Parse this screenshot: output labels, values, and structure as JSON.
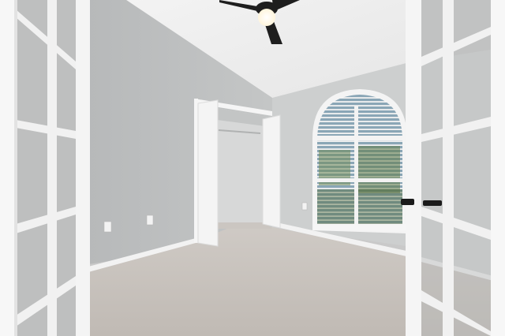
{
  "scene": {
    "description_kind": "real-estate-photo",
    "palette": {
      "ceiling": "#efefef",
      "left_wall": "#c1c3c3",
      "back_wall": "#cdcfcf",
      "right_wall": "#d0d1d1",
      "carpet": "#c9c4bf",
      "trim": "#f4f4f4",
      "fan": "#1e1e1e",
      "fan_light": "#fff8e6",
      "window_sky": "#9fb6c4",
      "window_green": "#5e7a47",
      "handle": "#1b1b1b"
    },
    "icons": {
      "ceiling_fan": "ceiling-fan-icon",
      "outlet": "outlet-icon",
      "door_handle": "door-handle-icon"
    }
  },
  "watermark": {
    "text": ""
  }
}
